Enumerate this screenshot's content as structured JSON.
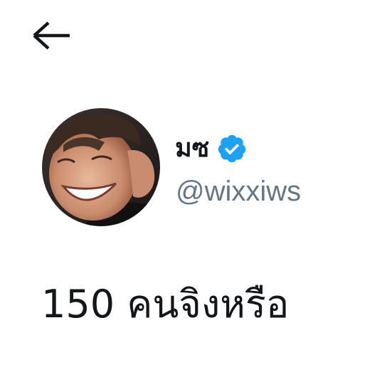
{
  "header": {
    "back_icon": "arrow-left-icon"
  },
  "author": {
    "display_name": "มซ",
    "handle": "@wixxiws",
    "verified": true,
    "verified_icon": "verified-badge-icon",
    "avatar_icon": "profile-photo",
    "colors": {
      "verified": "#1da1f2",
      "name": "#14171a",
      "handle": "#657786"
    }
  },
  "tweet": {
    "text": "150 คนจิงหรือ"
  }
}
